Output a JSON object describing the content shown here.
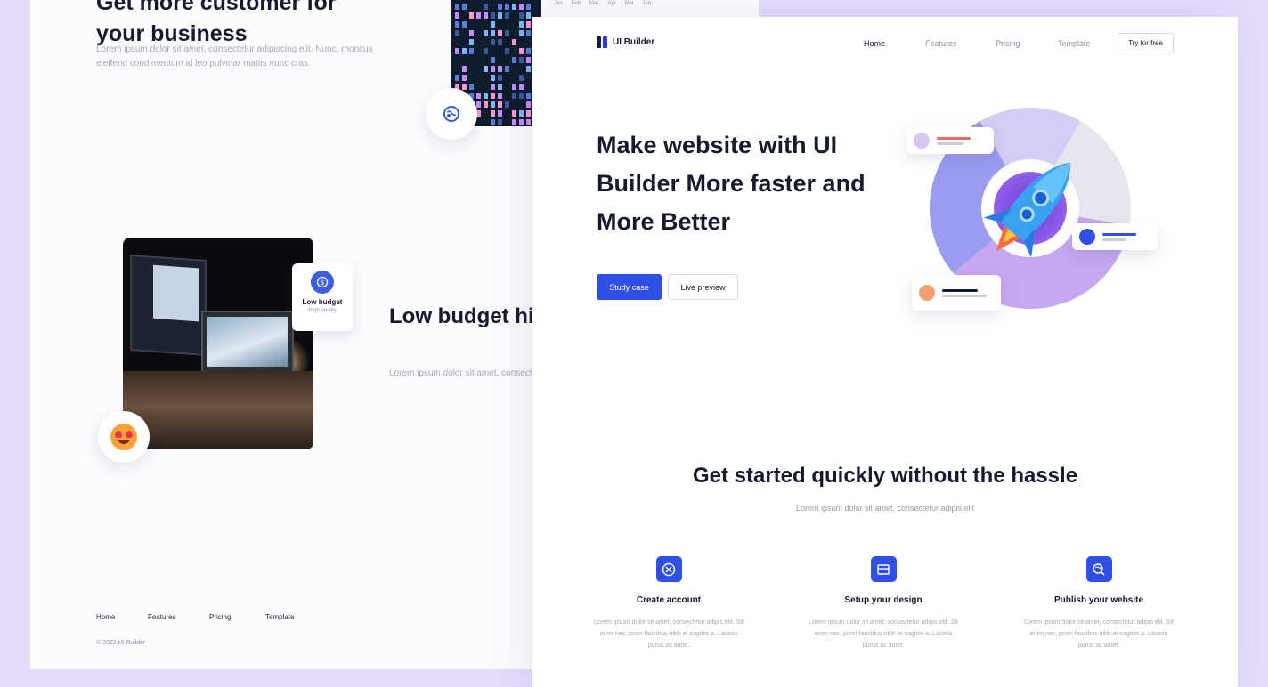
{
  "back_page": {
    "heading": "Get more customer for your business",
    "paragraph": "Lorem ipsum dolor sit amet, consectetur adipiscing elit. Nunc, rhoncus eleifend condimentum id leo pulvinar mattis nunc cras.",
    "calendar_months": [
      "Jan",
      "Feb",
      "Mar",
      "Apr",
      "Mei",
      "Jun"
    ],
    "budget_card": {
      "title": "Low budget",
      "subtitle": "High quality"
    },
    "feature_heading": "Low budget high look professional",
    "feature_paragraph": "Lorem ipsum dolor sit amet, consectetur rhoncus eleifend condimentum",
    "footer_nav": [
      "Home",
      "Features",
      "Pricing",
      "Template"
    ],
    "copyright": "© 2022 UI Builder"
  },
  "front_page": {
    "logo_text": "UI Builder",
    "nav": [
      "Home",
      "Features",
      "Pricing",
      "Template"
    ],
    "nav_active": "Home",
    "try_button": "Try for free",
    "hero_title": "Make website with UI Builder More faster and More Better",
    "primary_button": "Study case",
    "secondary_button": "Live preview",
    "section_title": "Get started quickly without the hassle",
    "section_subtitle": "Lorem ipsum dolor sit amet, consectetur adipis elit",
    "features": [
      {
        "title": "Create account",
        "desc": "Lorem ipsum dolor sit amet, consectetur adipis elit. Sit enim nec, proin faucibus nibh et sagittis a. Lacinia purus ac amet.",
        "icon": "user-circle-icon"
      },
      {
        "title": "Setup your design",
        "desc": "Lorem ipsum dolor sit amet, consectetur adipis elit. Sit enim nec, proin faucibus nibh et sagittis a. Lacinia purus ac amet.",
        "icon": "layout-icon"
      },
      {
        "title": "Publish your website",
        "desc": "Lorem ipsum dolor sit amet, consectetur adipis elit. Sit enim nec, proin faucibus nibh et sagittis a. Lacinia purus ac amet.",
        "icon": "globe-search-icon"
      }
    ]
  },
  "colors": {
    "background": "#e4dcf9",
    "primary": "#2f4fe6",
    "heading": "#161a2e",
    "muted": "#a5a7b6"
  }
}
